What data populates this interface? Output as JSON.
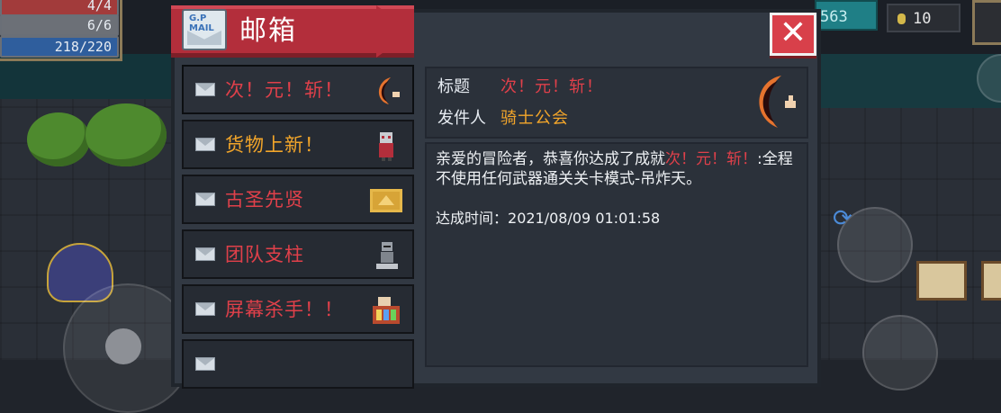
{
  "hud": {
    "hp": "4/4",
    "armor": "6/6",
    "energy": "218/220",
    "gems": "563",
    "coins": "10"
  },
  "window": {
    "title": "邮箱",
    "mail_icon_text": "G.P MAIL",
    "close_symbol": "✕"
  },
  "mails": [
    {
      "label": "次！元！斩！",
      "color": "red",
      "badge": "moon-blade-icon"
    },
    {
      "label": "货物上新！",
      "color": "orange",
      "badge": "merchant-icon"
    },
    {
      "label": "古圣先贤",
      "color": "red",
      "badge": "gold-tablet-icon"
    },
    {
      "label": "团队支柱",
      "color": "red",
      "badge": "knight-statue-icon"
    },
    {
      "label": "屏幕杀手！！",
      "color": "red",
      "badge": "slot-machine-icon"
    }
  ],
  "detail": {
    "title_label": "标题",
    "title_value": "次！元！斩！",
    "sender_label": "发件人",
    "sender_value": "骑士公会",
    "body_prefix": "亲爱的冒险者，恭喜你达成了成就",
    "body_achievement": "次！元！斩！",
    "body_suffix": ":全程不使用任何武器通关关卡模式-吊炸天。",
    "date_label": "达成时间：",
    "date_value": "2021/08/09 01:01:58"
  },
  "colors": {
    "ribbon": "#b32e3b",
    "highlight_red": "#e0404a",
    "highlight_orange": "#f2a52a",
    "panel": "#2b313a"
  }
}
